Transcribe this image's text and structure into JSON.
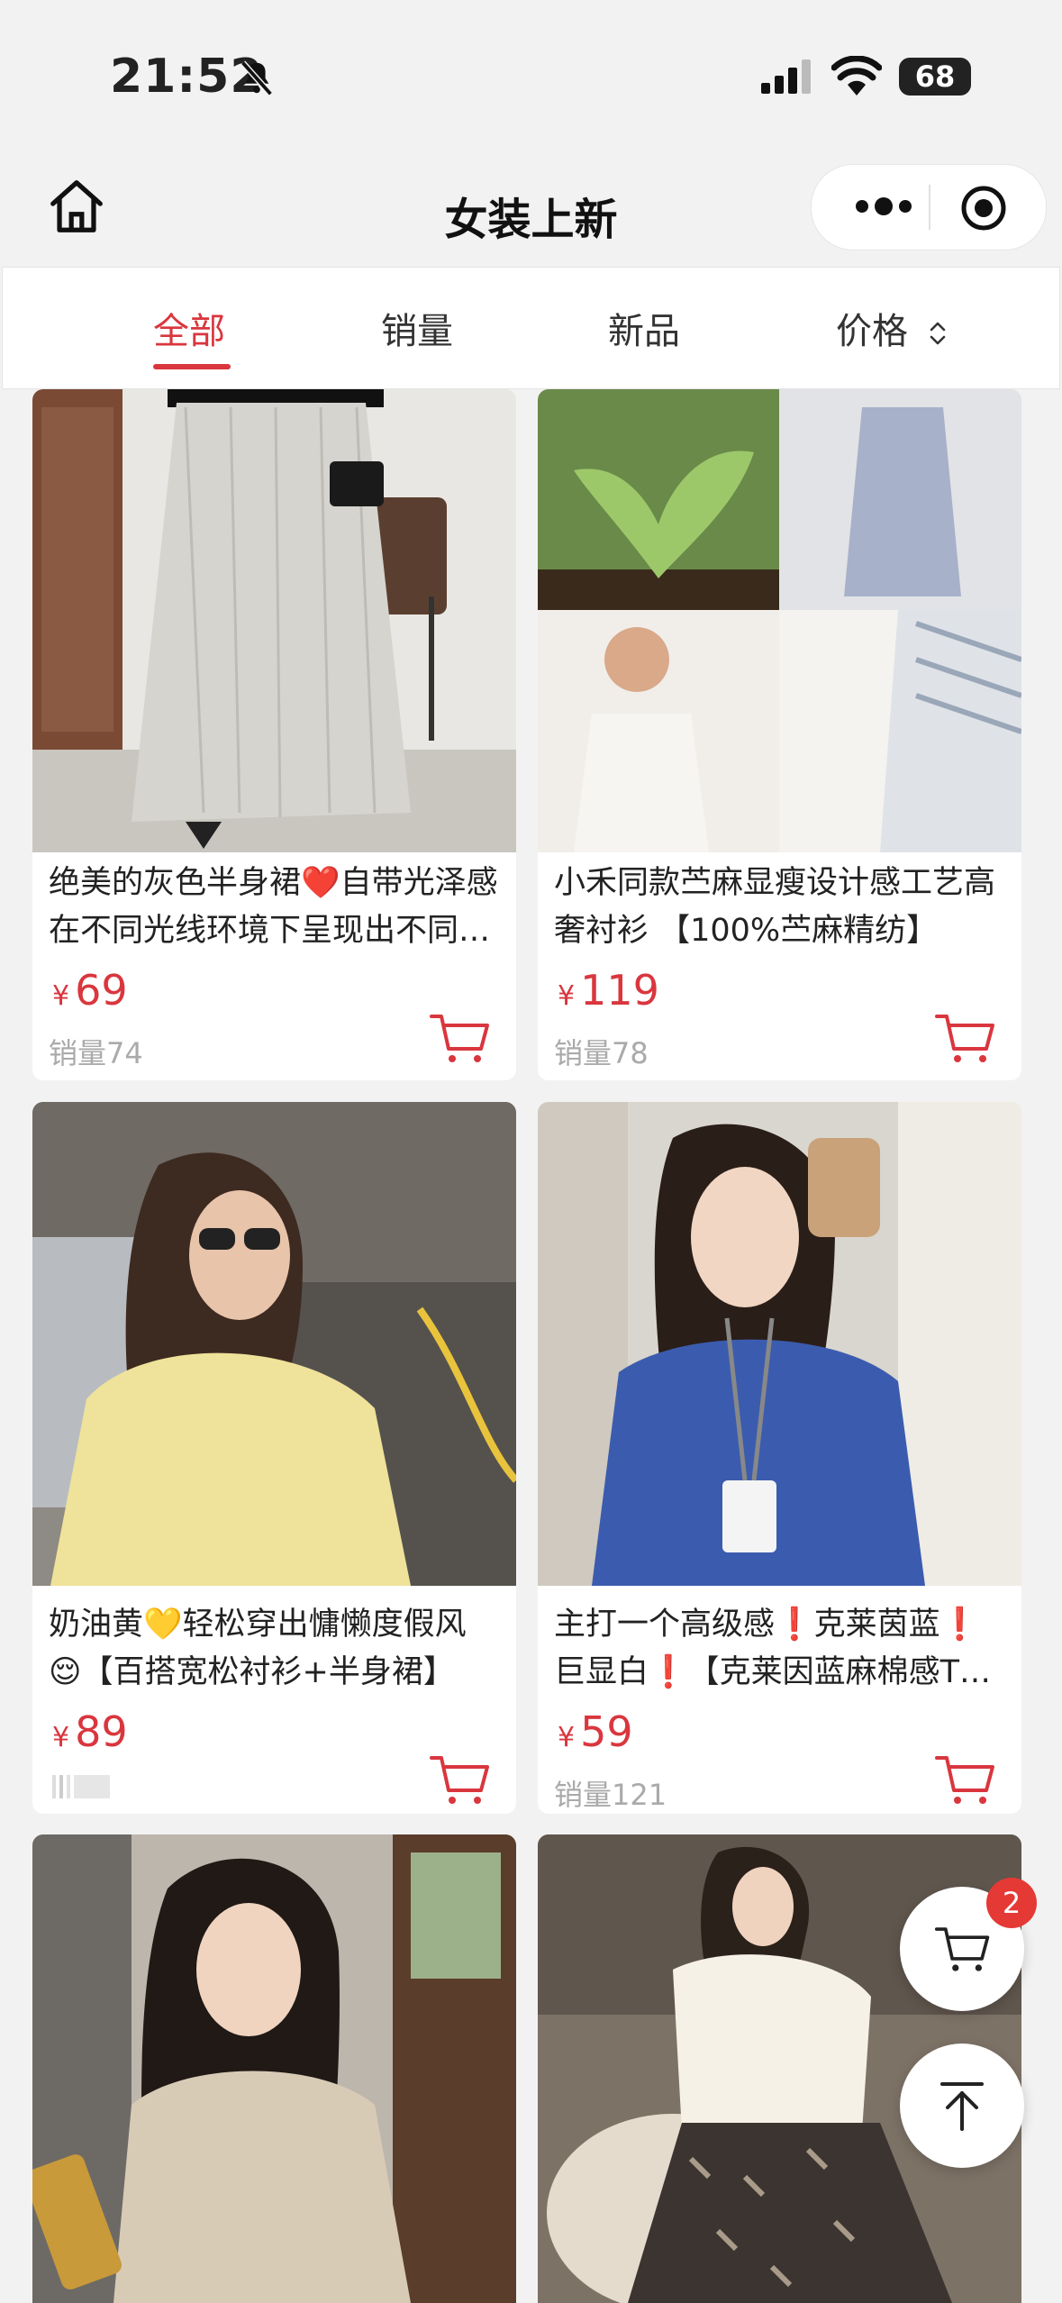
{
  "status_bar": {
    "time": "21:52",
    "battery": "68"
  },
  "nav": {
    "title": "女装上新"
  },
  "tabs": [
    {
      "label": "全部"
    },
    {
      "label": "销量"
    },
    {
      "label": "新品"
    },
    {
      "label": "价格"
    }
  ],
  "products": [
    {
      "title": "绝美的灰色半身裙❤️自带光泽感 在不同光线环境下呈现出不同的色彩",
      "currency": "¥",
      "price": "69",
      "sales": "销量74",
      "image": "grey-pleated-maxi-skirt"
    },
    {
      "title": "小禾同款苎麻显瘦设计感工艺高奢衬衫 【100%苎麻精纺】",
      "currency": "¥",
      "price": "119",
      "sales": "销量78",
      "image": "ramie-shirt-collage"
    },
    {
      "title": "奶油黄💛轻松穿出慵懒度假风😌【百搭宽松衬衫+半身裙】",
      "currency": "¥",
      "price": "89",
      "sales": "",
      "image": "yellow-shirt-woman"
    },
    {
      "title": "主打一个高级感❗克莱茵蓝❗巨显白❗【克莱因蓝麻棉感T恤】",
      "currency": "¥",
      "price": "59",
      "sales": "销量121",
      "image": "blue-tshirt-woman"
    },
    {
      "image": "beige-wrap-dress-woman"
    },
    {
      "image": "white-blouse-floral-skirt"
    }
  ],
  "floating": {
    "cart_badge": "2"
  },
  "colors": {
    "accent": "#d9363e",
    "background": "#f2f2f2"
  }
}
